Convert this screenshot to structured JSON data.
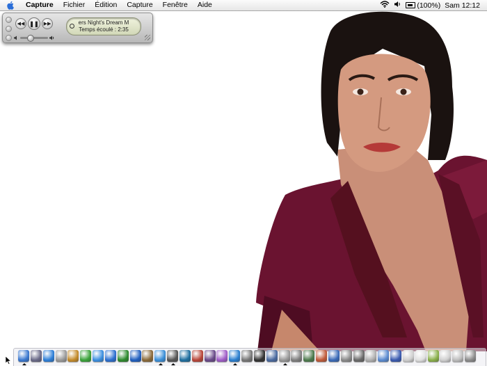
{
  "menubar": {
    "apple_icon": "apple-logo-icon",
    "app_name": "Capture",
    "menus": [
      "Fichier",
      "Édition",
      "Capture",
      "Fenêtre",
      "Aide"
    ],
    "battery_percent": "(100%)",
    "clock": "Sam 12:12",
    "status_icons": [
      "wifi-icon",
      "volume-icon",
      "battery-icon"
    ]
  },
  "mini_player": {
    "track_title": "ers Night's Dream    M",
    "elapsed": "Temps écoulé : 2:35",
    "volume_level": 0.35,
    "controls": [
      "previous-icon",
      "play-pause-icon",
      "next-icon"
    ]
  },
  "dock": {
    "items": [
      {
        "name": "finder",
        "color": "#3a78d0"
      },
      {
        "name": "app-2",
        "color": "#6a6a88"
      },
      {
        "name": "app-3",
        "color": "#2d7fd8"
      },
      {
        "name": "app-4",
        "color": "#9a9a9a"
      },
      {
        "name": "app-5",
        "color": "#c48b2a"
      },
      {
        "name": "app-6",
        "color": "#3aa33a"
      },
      {
        "name": "app-7",
        "color": "#3c8fe0"
      },
      {
        "name": "app-8",
        "color": "#2b6fd0"
      },
      {
        "name": "app-9",
        "color": "#2d8a2d"
      },
      {
        "name": "app-10",
        "color": "#1f5fc0"
      },
      {
        "name": "app-11",
        "color": "#8a6a3a"
      },
      {
        "name": "app-12",
        "color": "#3b8fd8"
      },
      {
        "name": "app-13",
        "color": "#555555"
      },
      {
        "name": "app-14",
        "color": "#1f6fa0"
      },
      {
        "name": "app-15",
        "color": "#b8463a"
      },
      {
        "name": "app-16",
        "color": "#6a4a8a"
      },
      {
        "name": "app-17",
        "color": "#a05cc8"
      },
      {
        "name": "app-18",
        "color": "#2a7fd0"
      },
      {
        "name": "app-19",
        "color": "#777777"
      },
      {
        "name": "app-20",
        "color": "#333333"
      },
      {
        "name": "app-21",
        "color": "#4a6aa0"
      },
      {
        "name": "app-22",
        "color": "#999999"
      },
      {
        "name": "app-23",
        "color": "#7f7f7f"
      },
      {
        "name": "app-24",
        "color": "#4d7a4d"
      },
      {
        "name": "app-25",
        "color": "#c05a3a"
      },
      {
        "name": "app-26",
        "color": "#3a6ab8"
      },
      {
        "name": "app-27",
        "color": "#8a8a8a"
      },
      {
        "name": "app-28",
        "color": "#6a6a6a"
      },
      {
        "name": "app-29",
        "color": "#b0b0b0"
      },
      {
        "name": "app-30",
        "color": "#5a8ad0"
      },
      {
        "name": "app-31",
        "color": "#3a5ab0"
      },
      {
        "name": "app-32",
        "color": "#cfcfcf"
      },
      {
        "name": "app-33",
        "color": "#e0e0e0"
      },
      {
        "name": "app-34",
        "color": "#8ab04a"
      },
      {
        "name": "app-35",
        "color": "#d0d0d0"
      },
      {
        "name": "app-36",
        "color": "#bdbdbd"
      },
      {
        "name": "trash",
        "color": "#8c8c8c"
      }
    ],
    "running": [
      0,
      11,
      12,
      17,
      21
    ]
  }
}
